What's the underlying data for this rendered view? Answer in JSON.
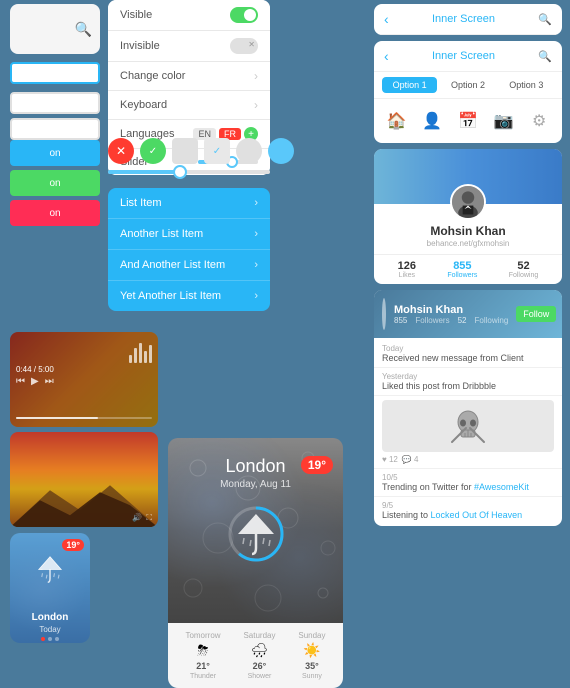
{
  "app": {
    "bg_color": "#4a7a9b"
  },
  "settings": {
    "rows": [
      {
        "label": "Visible",
        "control": "toggle-on"
      },
      {
        "label": "Invisible",
        "control": "toggle-x"
      },
      {
        "label": "Change color",
        "control": "chevron"
      },
      {
        "label": "Keyboard",
        "control": "chevron"
      },
      {
        "label": "Languages",
        "control": "languages"
      },
      {
        "label": "Slider",
        "control": "slider"
      }
    ],
    "languages": [
      "EN",
      "FR"
    ],
    "slider_value": 35
  },
  "list_items": [
    "List Item",
    "Another List Item",
    "And Another List Item",
    "Yet Another List Item"
  ],
  "color_boxes": [
    {
      "label": "on",
      "color": "#29b6f6",
      "text_color": "#fff"
    },
    {
      "label": "on",
      "color": "#4cd964",
      "text_color": "#fff"
    },
    {
      "label": "on",
      "color": "#ff2d55",
      "text_color": "#fff"
    }
  ],
  "weather_main": {
    "city": "London",
    "date": "Monday, Aug 11",
    "temp": "19°",
    "forecast": [
      {
        "day": "Tomorrow",
        "temp": "21°",
        "desc": "Thunder"
      },
      {
        "day": "Saturday",
        "temp": "26°",
        "desc": "Shower"
      },
      {
        "day": "Sunday",
        "temp": "35°",
        "desc": "Sunny"
      }
    ]
  },
  "weather_mini": {
    "city": "London",
    "day": "Today",
    "temp": "19"
  },
  "inner_screen_top": {
    "title": "Inner Screen",
    "back_label": "‹",
    "search_label": "🔍"
  },
  "inner_screen2": {
    "title": "Inner Screen",
    "tabs": [
      "Option 1",
      "Option 2",
      "Option 3"
    ],
    "active_tab": 0,
    "icons": [
      "🏠",
      "👤",
      "📅",
      "📷",
      "⚙"
    ]
  },
  "profile": {
    "name": "Mohsin Khan",
    "handle": "behance.net/gfxmohsin",
    "likes": "126",
    "followers": "855",
    "following": "52",
    "likes_label": "Likes",
    "followers_label": "Followers",
    "following_label": "Following"
  },
  "social": {
    "name": "Mohsin Khan",
    "followers": "855",
    "following": "52",
    "followers_label": "Followers",
    "following_label": "Following",
    "follow_btn": "Follow",
    "feed": [
      {
        "time": "Today",
        "text": "Received new message from Client",
        "has_image": false
      },
      {
        "time": "Yesterday",
        "text": "Liked this post from Dribbble",
        "has_image": false
      },
      {
        "time": "",
        "text": "",
        "has_image": true
      },
      {
        "time": "10/5",
        "text": "Trending on Twitter for #AwesomeKit",
        "has_image": false
      },
      {
        "time": "9/5",
        "text": "Listening to Locked Out Of Heaven",
        "has_image": false
      }
    ]
  },
  "media": {
    "time_current": "0:44",
    "time_total": "5:00"
  }
}
